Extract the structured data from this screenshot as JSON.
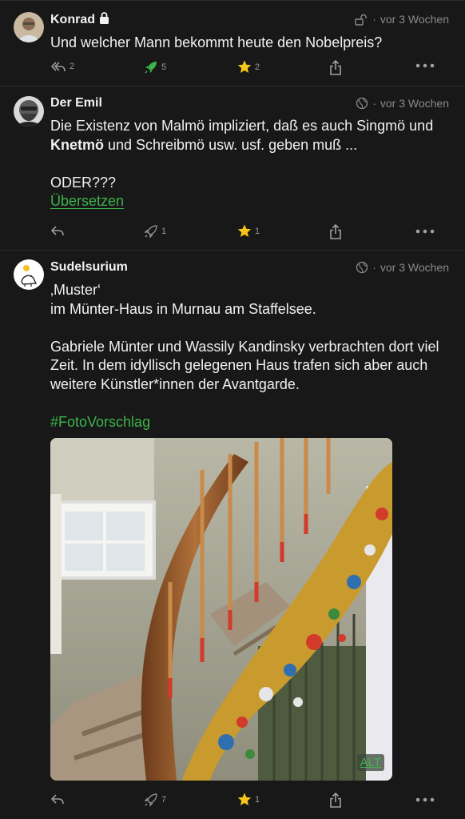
{
  "posts": [
    {
      "author": "Konrad",
      "time": "vor 3 Wochen",
      "text": "Und welcher Mann bekommt heute den Nobelpreis?",
      "replies": "2",
      "boosts": "5",
      "favs": "2",
      "visibility_icon": "unlock-icon",
      "author_badge_icon": "lock-icon"
    },
    {
      "author": "Der Emil",
      "time": "vor 3 Wochen",
      "text_part1": "Die Existenz von Malmö impliziert, daß es auch Singmö und ",
      "text_bold": "Knetmö",
      "text_part2": " und Schreibmö usw. usf. geben muß ...",
      "text_line2": "ODER???",
      "translate_label": "Übersetzen",
      "replies": "",
      "boosts": "1",
      "favs": "1",
      "visibility_icon": "globe-icon"
    },
    {
      "author": "Sudelsurium",
      "time": "vor 3 Wochen",
      "line1": "‚Muster‘",
      "line2": "im Münter-Haus in Murnau am Staffelsee.",
      "para2": "Gabriele Münter und Wassily Kandinsky verbrachten dort viel Zeit. In dem idyllisch gelegenen Haus trafen sich aber auch weitere Künstler*innen der Avantgarde.",
      "hashtag": "#FotoVorschlag",
      "alt_label": "ALT",
      "replies": "",
      "boosts": "7",
      "favs": "1",
      "visibility_icon": "globe-icon"
    }
  ],
  "colors": {
    "background": "#181818",
    "accent_green": "#3cb44b",
    "boost_active": "#3cb44b",
    "star": "#f5c518",
    "muted": "#8a8a8a"
  }
}
